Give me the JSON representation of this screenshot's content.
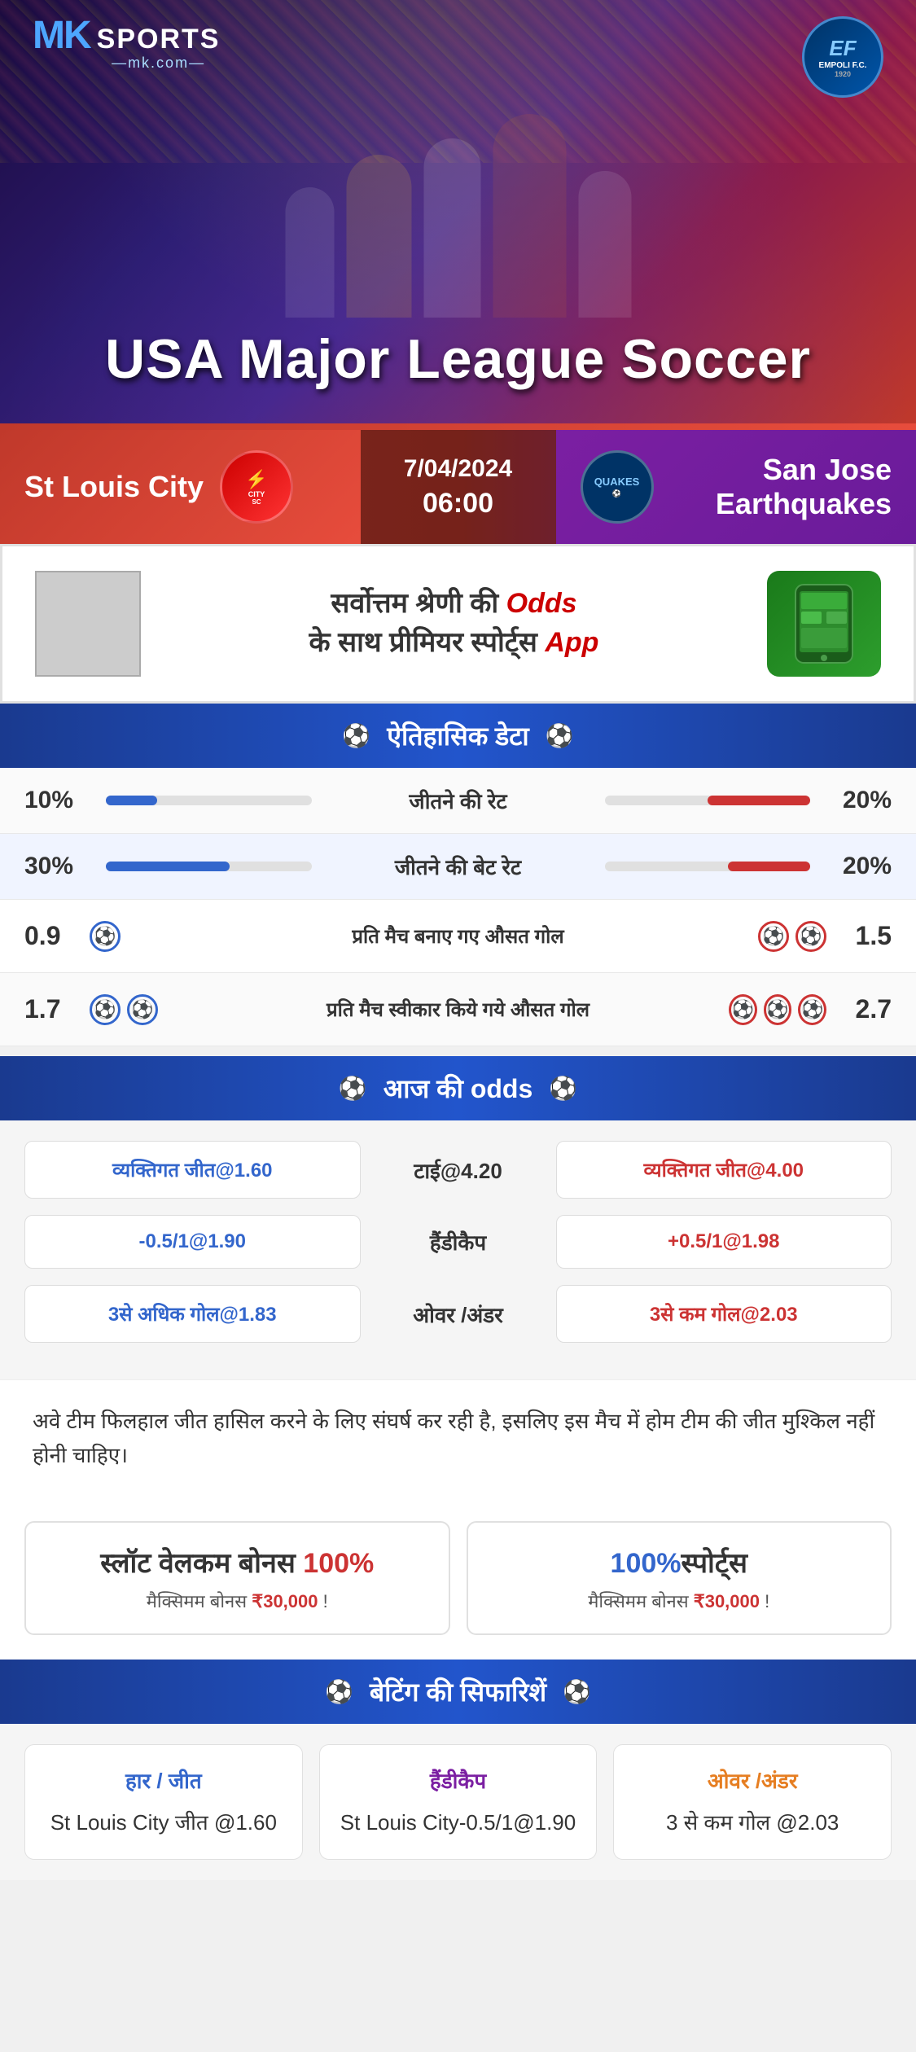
{
  "hero": {
    "title": "USA Major League Soccer",
    "logo_mk": "MK",
    "logo_sports": "SPORTS",
    "logo_site": "mk.com",
    "empoli_label": "EMPOLI F.C.",
    "empoli_ef": "EF",
    "empoli_year": "1920"
  },
  "match": {
    "home_team": "St Louis City",
    "away_team": "San Jose Earthquakes",
    "away_team_short": "QUAKES",
    "date": "7/04/2024",
    "time": "06:00"
  },
  "promo": {
    "text": "सर्वोत्तम श्रेणी की Odds के साथ प्रीमियर स्पोर्ट्स App"
  },
  "historical": {
    "header": "ऐतिहासिक डेटा",
    "rows": [
      {
        "label": "जीतने की रेट",
        "home_val": "10%",
        "away_val": "20%",
        "home_pct": 10,
        "away_pct": 20
      },
      {
        "label": "जीतने की बेट रेट",
        "home_val": "30%",
        "away_val": "20%",
        "home_pct": 30,
        "away_pct": 20
      },
      {
        "label": "प्रति मैच बनाए गए औसत गोल",
        "home_val": "0.9",
        "away_val": "1.5",
        "home_balls": 1,
        "away_balls": 2
      },
      {
        "label": "प्रति मैच स्वीकार किये गये औसत गोल",
        "home_val": "1.7",
        "away_val": "2.7",
        "home_balls": 2,
        "away_balls": 3
      }
    ]
  },
  "odds": {
    "header": "आज की odds",
    "rows": [
      {
        "home": "व्यक्तिगत जीत@1.60",
        "center": "टाई@4.20",
        "away": "व्यक्तिगत जीत@4.00"
      },
      {
        "home": "-0.5/1@1.90",
        "center": "हैंडीकैप",
        "away": "+0.5/1@1.98"
      },
      {
        "home": "3से अधिक गोल@1.83",
        "center": "ओवर /अंडर",
        "away": "3से कम गोल@2.03"
      }
    ]
  },
  "info_text": "अवे टीम फिलहाल जीत हासिल करने के लिए संघर्ष कर रही है, इसलिए इस मैच में होम टीम की जीत मुश्किल नहीं होनी चाहिए।",
  "bonus": {
    "card1_title": "स्लॉट वेलकम बोनस 100%",
    "card1_sub": "मैक्सिमम बोनस ₹30,000  !",
    "card2_title": "100%स्पोर्ट्स",
    "card2_sub": "मैक्सिमम बोनस  ₹30,000 !"
  },
  "betting_reco": {
    "header": "बेटिंग की सिफारिशें",
    "cards": [
      {
        "type": "हार / जीत",
        "value": "St Louis City जीत @1.60",
        "color": "blue"
      },
      {
        "type": "हैंडीकैप",
        "value": "St Louis City-0.5/1@1.90",
        "color": "purple"
      },
      {
        "type": "ओवर /अंडर",
        "value": "3 से कम गोल @2.03",
        "color": "orange"
      }
    ]
  }
}
